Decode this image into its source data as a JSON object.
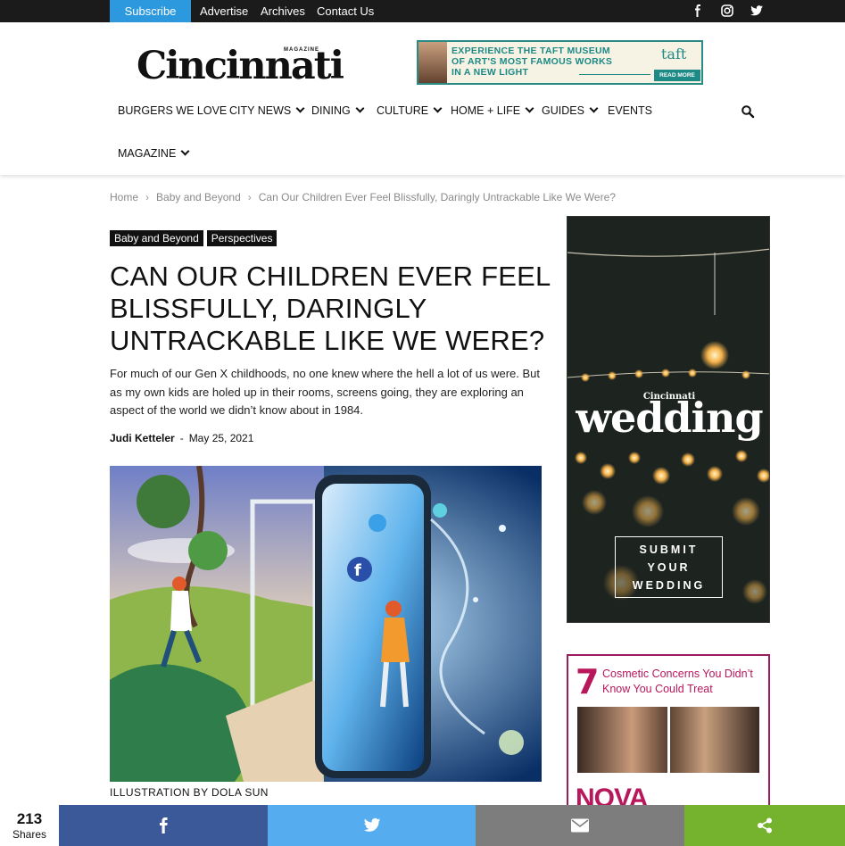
{
  "topbar": {
    "subscribe": "Subscribe",
    "links": [
      "Advertise",
      "Archives",
      "Contact Us"
    ],
    "social_icons": [
      "facebook-icon",
      "instagram-icon",
      "twitter-icon"
    ]
  },
  "header": {
    "logo_text": "Cincinnati",
    "logo_sub": "MAGAZINE",
    "ad": {
      "line1": "EXPERIENCE THE TAFT MUSEUM",
      "line2": "OF ART'S MOST FAMOUS WORKS",
      "line3": "IN A NEW LIGHT",
      "brand": "taft",
      "button": "READ MORE",
      "accent": "#1d8a86"
    }
  },
  "nav": {
    "items": [
      "BURGERS WE LOVE",
      "CITY NEWS",
      "DINING",
      "CULTURE",
      "HOME + LIFE",
      "GUIDES",
      "EVENTS"
    ],
    "row2": "MAGAZINE",
    "search_icon": "search-icon"
  },
  "breadcrumb": [
    "Home",
    "Baby and Beyond",
    "Can Our Children Ever Feel Blissfully, Daringly Untrackable Like We Were?"
  ],
  "article": {
    "tags": [
      "Baby and Beyond",
      "Perspectives"
    ],
    "title": "CAN OUR CHILDREN EVER FEEL BLISSFULLY, DARINGLY UNTRACKABLE LIKE WE WERE?",
    "dek": "For much of our Gen X childhoods, no one knew where the hell a lot of us were. But as my own kids are holed up in their rooms, screens going, they are exploring an aspect of the world we didn’t know about in 1984.",
    "author": "Judi Ketteler",
    "date": "May 25, 2021",
    "caption": "ILLUSTRATION BY DOLA SUN"
  },
  "sidebar": {
    "wedding_ad": {
      "brand": "Cincinnati",
      "word": "wedding",
      "button_lines": [
        "SUBMIT",
        "YOUR",
        "WEDDING"
      ]
    },
    "cosmetic_ad": {
      "number": "7",
      "text": "Cosmetic Concerns You Didn’t Know You Could Treat",
      "logo": "NOVA",
      "accent": "#b8175c"
    }
  },
  "share": {
    "count": "213",
    "label": "Shares",
    "colors": {
      "facebook": "#3b5998",
      "twitter": "#55acee",
      "email": "#7d7d7d",
      "share": "#75b22e"
    }
  }
}
